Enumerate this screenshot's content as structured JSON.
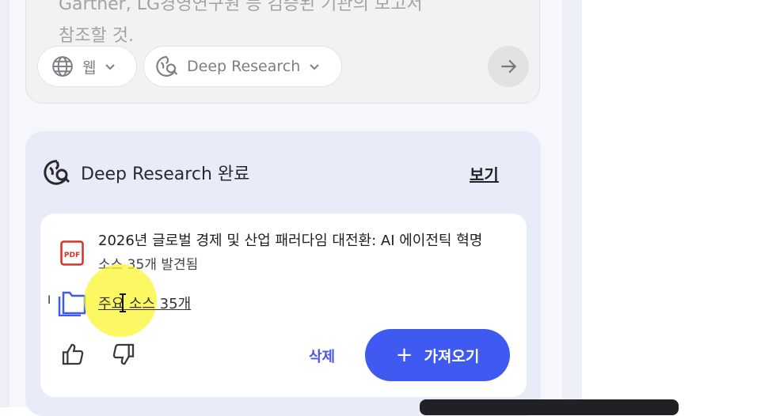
{
  "prompt": {
    "text_line1": "Gartner, LG경영연구원 등 검증된 기관의 보고서",
    "text_line2": "참조할 것."
  },
  "chips": {
    "web_label": "웹",
    "mode_label": "Deep Research"
  },
  "result": {
    "title": "Deep Research 완료",
    "view_label": "보기",
    "doc_title": "2026년 글로벌 경제 및 산업 패러다임 대전환: AI 에이전틱 혁명",
    "doc_sub": "소스 35개 발견됨",
    "sources_link": "주요 소스 35개",
    "delete_label": "삭제",
    "import_label": "가져오기",
    "import_icon": "+"
  },
  "colors": {
    "accent": "#3f5af0",
    "pdf_red": "#d93025",
    "folder_blue": "#3f5af0"
  }
}
